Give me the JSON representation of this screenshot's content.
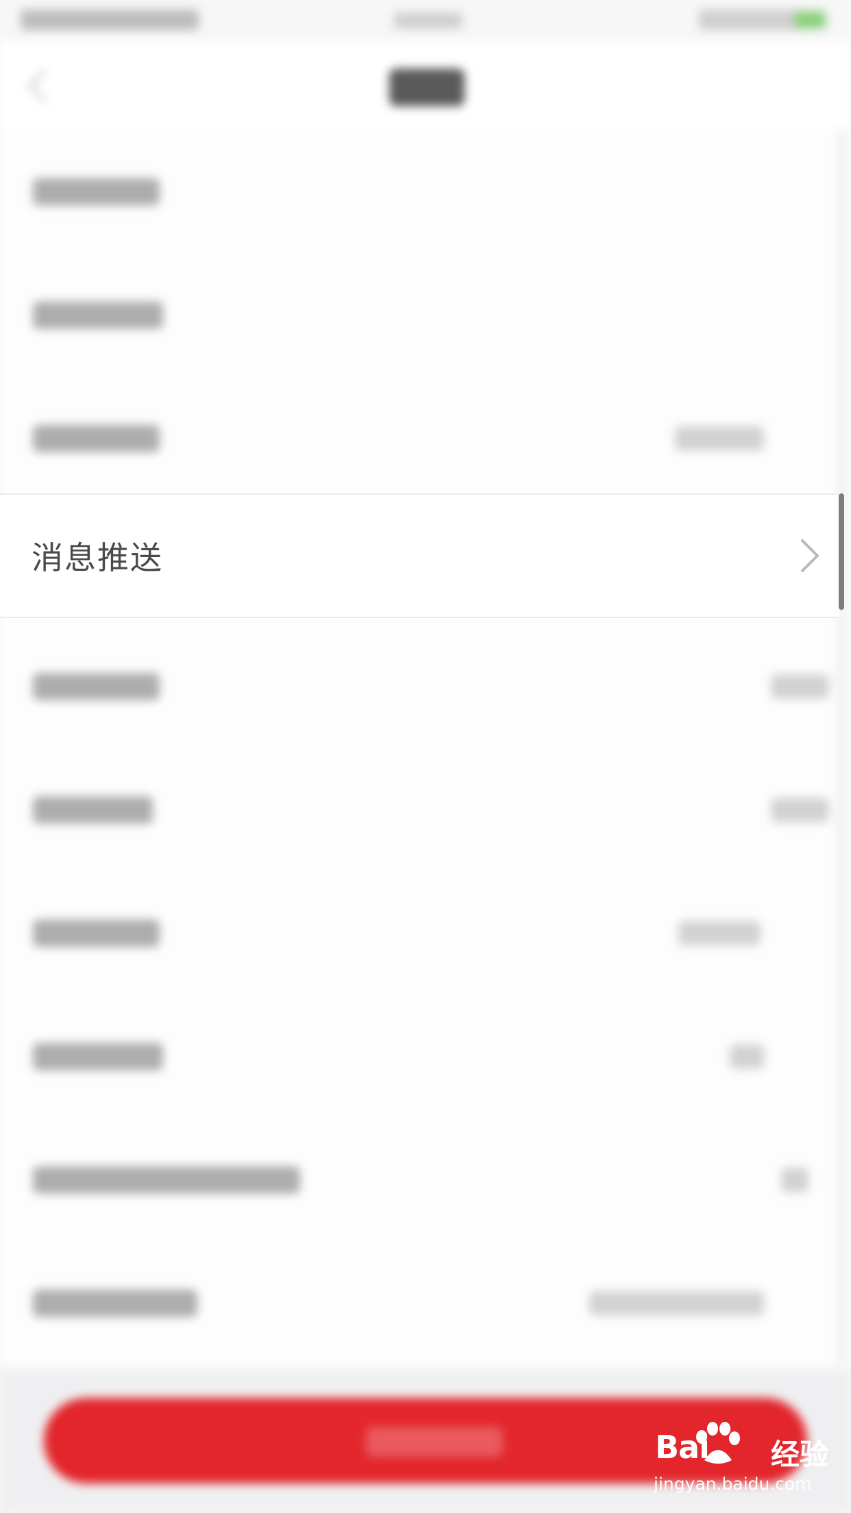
{
  "settings_list": {
    "focused_item": {
      "label": "消息推送"
    }
  },
  "watermark": {
    "brand": "Bai",
    "brand_suffix": "经验",
    "url": "jingyan.baidu.com"
  },
  "colors": {
    "accent_button": "#e2262c",
    "focused_row_bg": "#ffffff",
    "label_text": "#4a4a4a"
  },
  "icons": {
    "row_chevron": "chevron-right-icon",
    "back": "back-arrow-icon",
    "watermark_logo": "baidu-paw-icon"
  }
}
